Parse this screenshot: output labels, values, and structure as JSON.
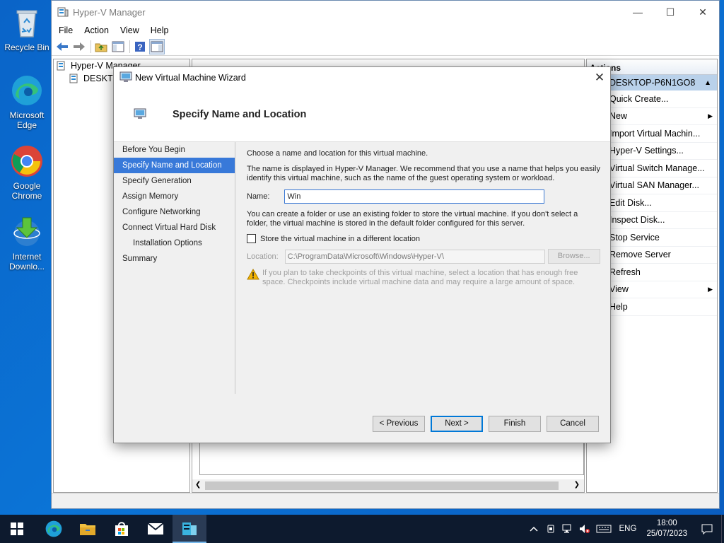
{
  "desktop": {
    "icons": [
      {
        "label": "Recycle Bin"
      },
      {
        "label": "Microsoft Edge"
      },
      {
        "label": "Google Chrome"
      },
      {
        "label": "Internet Downlo..."
      }
    ]
  },
  "main_window": {
    "title": "Hyper-V Manager",
    "menu": [
      "File",
      "Action",
      "View",
      "Help"
    ],
    "tree": {
      "root": "Hyper-V Manager",
      "host": "DESKTOP-P6N1GO8"
    },
    "actions": {
      "header": "Actions",
      "selected": "DESKTOP-P6N1GO8",
      "items": [
        {
          "label": "Quick Create...",
          "submenu": false
        },
        {
          "label": "New",
          "submenu": true
        },
        {
          "label": "Import Virtual Machin...",
          "submenu": false
        },
        {
          "label": "Hyper-V Settings...",
          "submenu": false
        },
        {
          "label": "Virtual Switch Manage...",
          "submenu": false
        },
        {
          "label": "Virtual SAN Manager...",
          "submenu": false
        },
        {
          "label": "Edit Disk...",
          "submenu": false
        },
        {
          "label": "Inspect Disk...",
          "submenu": false
        },
        {
          "label": "Stop Service",
          "submenu": false
        },
        {
          "label": "Remove Server",
          "submenu": false
        },
        {
          "label": "Refresh",
          "submenu": false
        },
        {
          "label": "View",
          "submenu": true
        },
        {
          "label": "Help",
          "submenu": false
        }
      ]
    }
  },
  "wizard": {
    "title": "New Virtual Machine Wizard",
    "heading": "Specify Name and Location",
    "nav": [
      {
        "label": "Before You Begin",
        "active": false,
        "sub": false
      },
      {
        "label": "Specify Name and Location",
        "active": true,
        "sub": false
      },
      {
        "label": "Specify Generation",
        "active": false,
        "sub": false
      },
      {
        "label": "Assign Memory",
        "active": false,
        "sub": false
      },
      {
        "label": "Configure Networking",
        "active": false,
        "sub": false
      },
      {
        "label": "Connect Virtual Hard Disk",
        "active": false,
        "sub": false
      },
      {
        "label": "Installation Options",
        "active": false,
        "sub": true
      },
      {
        "label": "Summary",
        "active": false,
        "sub": false
      }
    ],
    "intro": "Choose a name and location for this virtual machine.",
    "name_help_1": "The name is displayed in Hyper-V Manager. We recommend that you use a name that helps you easily",
    "name_help_2": "identify this virtual machine, such as the name of the guest operating system or workload.",
    "name_label": "Name:",
    "name_value": "Win",
    "folder_help_1": "You can create a folder or use an existing folder to store the virtual machine. If you don't select a",
    "folder_help_2": "folder, the virtual machine is stored in the default folder configured for this server.",
    "store_checkbox_label": "Store the virtual machine in a different location",
    "store_checked": false,
    "location_label": "Location:",
    "location_value": "C:\\ProgramData\\Microsoft\\Windows\\Hyper-V\\",
    "browse_label": "Browse...",
    "warning_1": "If you plan to take checkpoints of this virtual machine, select a location that has enough free",
    "warning_2": "space. Checkpoints include virtual machine data and may require a large amount of space.",
    "buttons": {
      "previous": "< Previous",
      "next": "Next >",
      "finish": "Finish",
      "cancel": "Cancel"
    }
  },
  "taskbar": {
    "language": "ENG",
    "time": "18:00",
    "date": "25/07/2023"
  },
  "colors": {
    "accent": "#3879d9",
    "desktop": "#0a64c8",
    "taskbar": "#0d1a2e"
  }
}
